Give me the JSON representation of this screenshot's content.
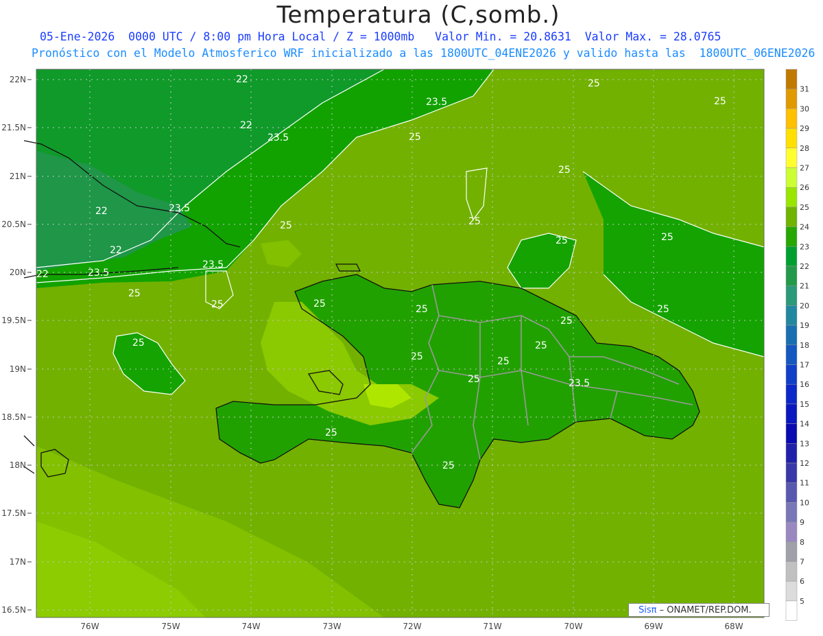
{
  "header": {
    "title": "Temperatura (C,somb.)",
    "line1": "05-Ene-2026  0000 UTC / 8:00 pm Hora Local / Z = 1000mb   Valor Min. = 20.8631  Valor Max. = 28.0765",
    "line2": "Pronóstico con el Modelo Atmosferico WRF inicializado a las 1800UTC_04ENE2026 y valido hasta las  1800UTC_06ENE2026"
  },
  "map": {
    "lat_labels": [
      "22N",
      "21.5N",
      "21N",
      "20.5N",
      "20N",
      "19.5N",
      "19N",
      "18.5N",
      "18N",
      "17.5N",
      "17N",
      "16.5N"
    ],
    "lon_labels": [
      "76W",
      "75W",
      "74W",
      "73W",
      "72W",
      "71W",
      "70W",
      "69W",
      "68W"
    ],
    "contour_labels": [
      "22",
      "22",
      "22",
      "22",
      "22",
      "23.5",
      "23.5",
      "23.5",
      "23.5",
      "23.5",
      "25",
      "25",
      "25",
      "25",
      "25",
      "25",
      "25",
      "25",
      "25",
      "25",
      "25",
      "25",
      "25",
      "25",
      "25",
      "25",
      "25",
      "25",
      "25",
      "25",
      "25",
      "23.5"
    ]
  },
  "colorbar": {
    "labels": [
      "31",
      "30",
      "29",
      "28",
      "27",
      "26",
      "25",
      "24",
      "23",
      "22",
      "21",
      "20",
      "19",
      "18",
      "17",
      "16",
      "15",
      "14",
      "13",
      "12",
      "11",
      "10",
      "9",
      "8",
      "7",
      "6",
      "5"
    ],
    "colors": [
      "#c07a00",
      "#e09a00",
      "#ffc000",
      "#ffe000",
      "#ffff30",
      "#ccff33",
      "#99e600",
      "#6fb400",
      "#26a800",
      "#00a030",
      "#229a4a",
      "#2a9a78",
      "#2188a0",
      "#1970b0",
      "#1458c0",
      "#1040c8",
      "#0c28c8",
      "#0a18c0",
      "#0a0ab0",
      "#2020a8",
      "#3838a8",
      "#5858b0",
      "#7878b8",
      "#9a88c0",
      "#a0a0a8",
      "#c0c0c0",
      "#dcdcdc",
      "#ffffff"
    ]
  },
  "credit": {
    "sis": "Sisπ",
    "rest": "– ONAMET/REP.DOM."
  }
}
